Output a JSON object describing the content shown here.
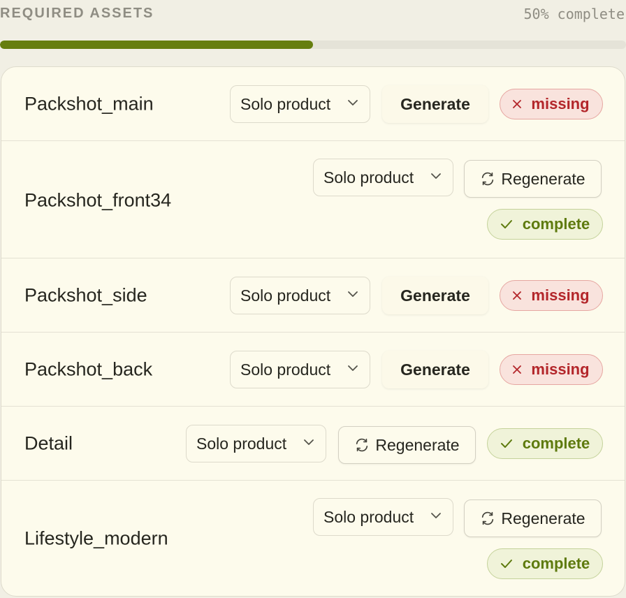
{
  "header": {
    "title": "REQUIRED ASSETS",
    "progress_text": "50% complete",
    "progress_fraction": 0.5
  },
  "colors": {
    "accent": "#667e0f",
    "missing": "#b3262a",
    "complete": "#5e7a0e"
  },
  "assets": [
    {
      "name": "Packshot_main",
      "select_value": "Solo product",
      "action_label": "Generate",
      "action_icon": "",
      "status_label": "missing",
      "status_icon": "x-icon"
    },
    {
      "name": "Packshot_front34",
      "select_value": "Solo product",
      "action_label": "Regenerate",
      "action_icon": "refresh-icon",
      "status_label": "complete",
      "status_icon": "check-icon"
    },
    {
      "name": "Packshot_side",
      "select_value": "Solo product",
      "action_label": "Generate",
      "action_icon": "",
      "status_label": "missing",
      "status_icon": "x-icon"
    },
    {
      "name": "Packshot_back",
      "select_value": "Solo product",
      "action_label": "Generate",
      "action_icon": "",
      "status_label": "missing",
      "status_icon": "x-icon"
    },
    {
      "name": "Detail",
      "select_value": "Solo product",
      "action_label": "Regenerate",
      "action_icon": "refresh-icon",
      "status_label": "complete",
      "status_icon": "check-icon"
    },
    {
      "name": "Lifestyle_modern",
      "select_value": "Solo product",
      "action_label": "Regenerate",
      "action_icon": "refresh-icon",
      "status_label": "complete",
      "status_icon": "check-icon"
    }
  ]
}
